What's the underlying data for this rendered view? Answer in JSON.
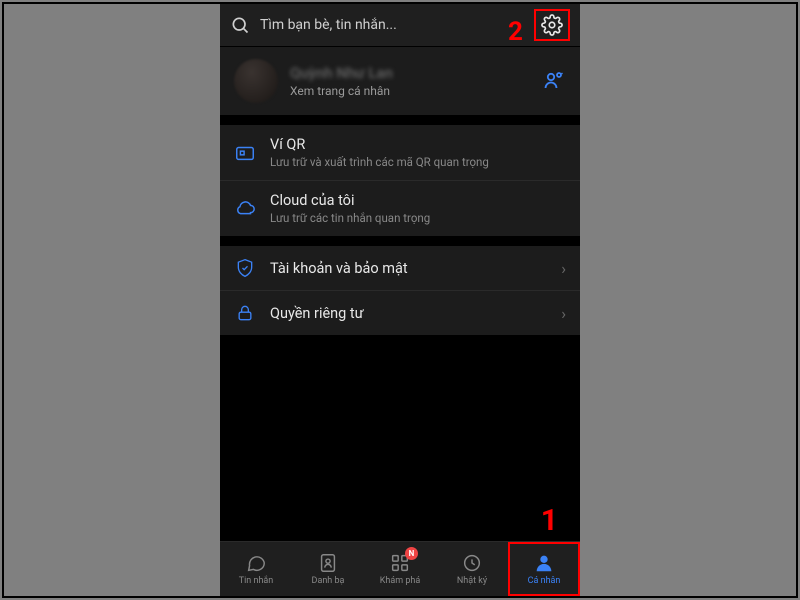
{
  "search": {
    "placeholder": "Tìm bạn bè, tin nhắn..."
  },
  "annotations": {
    "one": "1",
    "two": "2"
  },
  "profile": {
    "name": "Quỳnh Như Lan",
    "subtitle": "Xem trang cá nhân"
  },
  "items": {
    "qr": {
      "title": "Ví QR",
      "sub": "Lưu trữ và xuất trình các mã QR quan trọng"
    },
    "cloud": {
      "title": "Cloud của tôi",
      "sub": "Lưu trữ các tin nhắn quan trọng"
    },
    "security": {
      "title": "Tài khoản và bảo mật"
    },
    "privacy": {
      "title": "Quyền riêng tư"
    }
  },
  "tabs": {
    "messages": "Tin nhắn",
    "contacts": "Danh bạ",
    "discover": "Khám phá",
    "journal": "Nhật ký",
    "me": "Cá nhân",
    "badge": "N"
  }
}
